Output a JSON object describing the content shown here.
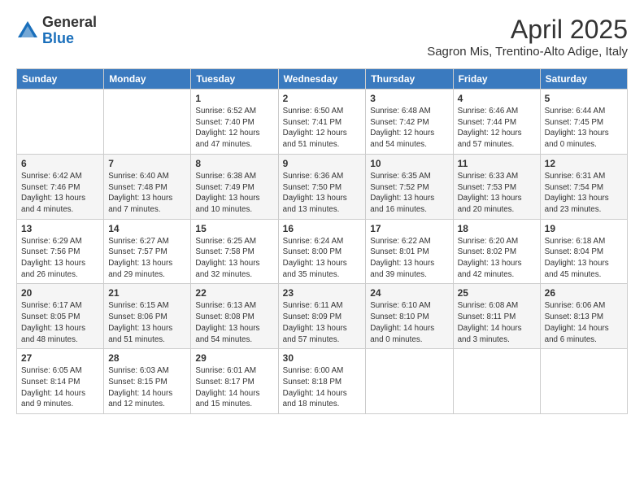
{
  "header": {
    "logo_general": "General",
    "logo_blue": "Blue",
    "title": "April 2025",
    "subtitle": "Sagron Mis, Trentino-Alto Adige, Italy"
  },
  "weekdays": [
    "Sunday",
    "Monday",
    "Tuesday",
    "Wednesday",
    "Thursday",
    "Friday",
    "Saturday"
  ],
  "weeks": [
    [
      {
        "day": "",
        "info": ""
      },
      {
        "day": "",
        "info": ""
      },
      {
        "day": "1",
        "info": "Sunrise: 6:52 AM\nSunset: 7:40 PM\nDaylight: 12 hours and 47 minutes."
      },
      {
        "day": "2",
        "info": "Sunrise: 6:50 AM\nSunset: 7:41 PM\nDaylight: 12 hours and 51 minutes."
      },
      {
        "day": "3",
        "info": "Sunrise: 6:48 AM\nSunset: 7:42 PM\nDaylight: 12 hours and 54 minutes."
      },
      {
        "day": "4",
        "info": "Sunrise: 6:46 AM\nSunset: 7:44 PM\nDaylight: 12 hours and 57 minutes."
      },
      {
        "day": "5",
        "info": "Sunrise: 6:44 AM\nSunset: 7:45 PM\nDaylight: 13 hours and 0 minutes."
      }
    ],
    [
      {
        "day": "6",
        "info": "Sunrise: 6:42 AM\nSunset: 7:46 PM\nDaylight: 13 hours and 4 minutes."
      },
      {
        "day": "7",
        "info": "Sunrise: 6:40 AM\nSunset: 7:48 PM\nDaylight: 13 hours and 7 minutes."
      },
      {
        "day": "8",
        "info": "Sunrise: 6:38 AM\nSunset: 7:49 PM\nDaylight: 13 hours and 10 minutes."
      },
      {
        "day": "9",
        "info": "Sunrise: 6:36 AM\nSunset: 7:50 PM\nDaylight: 13 hours and 13 minutes."
      },
      {
        "day": "10",
        "info": "Sunrise: 6:35 AM\nSunset: 7:52 PM\nDaylight: 13 hours and 16 minutes."
      },
      {
        "day": "11",
        "info": "Sunrise: 6:33 AM\nSunset: 7:53 PM\nDaylight: 13 hours and 20 minutes."
      },
      {
        "day": "12",
        "info": "Sunrise: 6:31 AM\nSunset: 7:54 PM\nDaylight: 13 hours and 23 minutes."
      }
    ],
    [
      {
        "day": "13",
        "info": "Sunrise: 6:29 AM\nSunset: 7:56 PM\nDaylight: 13 hours and 26 minutes."
      },
      {
        "day": "14",
        "info": "Sunrise: 6:27 AM\nSunset: 7:57 PM\nDaylight: 13 hours and 29 minutes."
      },
      {
        "day": "15",
        "info": "Sunrise: 6:25 AM\nSunset: 7:58 PM\nDaylight: 13 hours and 32 minutes."
      },
      {
        "day": "16",
        "info": "Sunrise: 6:24 AM\nSunset: 8:00 PM\nDaylight: 13 hours and 35 minutes."
      },
      {
        "day": "17",
        "info": "Sunrise: 6:22 AM\nSunset: 8:01 PM\nDaylight: 13 hours and 39 minutes."
      },
      {
        "day": "18",
        "info": "Sunrise: 6:20 AM\nSunset: 8:02 PM\nDaylight: 13 hours and 42 minutes."
      },
      {
        "day": "19",
        "info": "Sunrise: 6:18 AM\nSunset: 8:04 PM\nDaylight: 13 hours and 45 minutes."
      }
    ],
    [
      {
        "day": "20",
        "info": "Sunrise: 6:17 AM\nSunset: 8:05 PM\nDaylight: 13 hours and 48 minutes."
      },
      {
        "day": "21",
        "info": "Sunrise: 6:15 AM\nSunset: 8:06 PM\nDaylight: 13 hours and 51 minutes."
      },
      {
        "day": "22",
        "info": "Sunrise: 6:13 AM\nSunset: 8:08 PM\nDaylight: 13 hours and 54 minutes."
      },
      {
        "day": "23",
        "info": "Sunrise: 6:11 AM\nSunset: 8:09 PM\nDaylight: 13 hours and 57 minutes."
      },
      {
        "day": "24",
        "info": "Sunrise: 6:10 AM\nSunset: 8:10 PM\nDaylight: 14 hours and 0 minutes."
      },
      {
        "day": "25",
        "info": "Sunrise: 6:08 AM\nSunset: 8:11 PM\nDaylight: 14 hours and 3 minutes."
      },
      {
        "day": "26",
        "info": "Sunrise: 6:06 AM\nSunset: 8:13 PM\nDaylight: 14 hours and 6 minutes."
      }
    ],
    [
      {
        "day": "27",
        "info": "Sunrise: 6:05 AM\nSunset: 8:14 PM\nDaylight: 14 hours and 9 minutes."
      },
      {
        "day": "28",
        "info": "Sunrise: 6:03 AM\nSunset: 8:15 PM\nDaylight: 14 hours and 12 minutes."
      },
      {
        "day": "29",
        "info": "Sunrise: 6:01 AM\nSunset: 8:17 PM\nDaylight: 14 hours and 15 minutes."
      },
      {
        "day": "30",
        "info": "Sunrise: 6:00 AM\nSunset: 8:18 PM\nDaylight: 14 hours and 18 minutes."
      },
      {
        "day": "",
        "info": ""
      },
      {
        "day": "",
        "info": ""
      },
      {
        "day": "",
        "info": ""
      }
    ]
  ]
}
